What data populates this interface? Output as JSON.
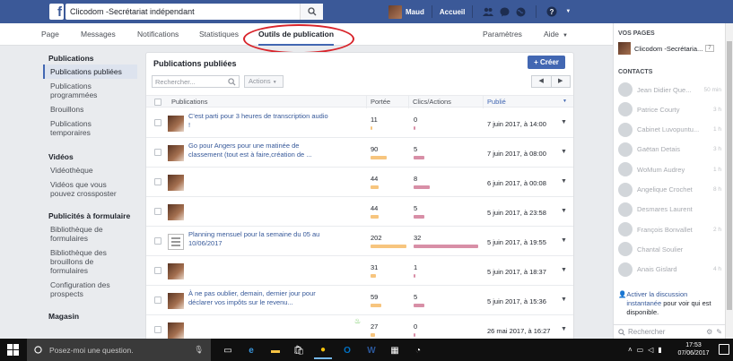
{
  "topbar": {
    "page_name": "Clicodom -Secrétariat indépendant",
    "user_name": "Maud",
    "home_label": "Accueil"
  },
  "tabs": [
    {
      "label": "Page"
    },
    {
      "label": "Messages"
    },
    {
      "label": "Notifications"
    },
    {
      "label": "Statistiques"
    },
    {
      "label": "Outils de publication",
      "active": true
    },
    {
      "label": "Paramètres"
    },
    {
      "label": "Aide"
    }
  ],
  "leftnav": {
    "sections": [
      {
        "heading": "Publications",
        "items": [
          "Publications publiées",
          "Publications programmées",
          "Brouillons",
          "Publications temporaires"
        ]
      },
      {
        "heading": "Vidéos",
        "items": [
          "Vidéothèque",
          "Vidéos que vous pouvez crossposter"
        ]
      },
      {
        "heading": "Publicités à formulaire",
        "items": [
          "Bibliothèque de formulaires",
          "Bibliothèque des brouillons de formulaires",
          "Configuration des prospects"
        ]
      },
      {
        "heading": "Magasin",
        "items": []
      }
    ],
    "active_item": "Publications publiées"
  },
  "main": {
    "title": "Publications publiées",
    "create_label": "+ Créer",
    "search_placeholder": "Rechercher...",
    "actions_label": "Actions",
    "pager_prev": "◀",
    "pager_next": "▶",
    "columns": {
      "publications": "Publications",
      "reach": "Portée",
      "clicks": "Clics/Actions",
      "published": "Publié"
    },
    "rows": [
      {
        "title": "C'est parti pour 3 heures de transcription audio !",
        "reach": "11",
        "reach_frac": 0.05,
        "clicks": "0",
        "clicks_frac": 0.0,
        "date": "7 juin 2017, à 14:00",
        "thumb": "photo",
        "boost": false
      },
      {
        "title": "Go pour Angers pour une matinée de classement (tout est à faire,création de ...",
        "reach": "90",
        "reach_frac": 0.45,
        "clicks": "5",
        "clicks_frac": 0.16,
        "date": "7 juin 2017, à 08:00",
        "thumb": "photo",
        "boost": false
      },
      {
        "title": "",
        "reach": "44",
        "reach_frac": 0.22,
        "clicks": "8",
        "clicks_frac": 0.25,
        "date": "6 juin 2017, à 00:08",
        "thumb": "photo",
        "boost": false
      },
      {
        "title": "",
        "reach": "44",
        "reach_frac": 0.22,
        "clicks": "5",
        "clicks_frac": 0.16,
        "date": "5 juin 2017, à 23:58",
        "thumb": "photo",
        "boost": false
      },
      {
        "title": "Planning mensuel pour la semaine du 05 au 10/06/2017",
        "reach": "202",
        "reach_frac": 1.0,
        "clicks": "32",
        "clicks_frac": 1.0,
        "date": "5 juin 2017, à 19:55",
        "thumb": "doc",
        "boost": false
      },
      {
        "title": "",
        "reach": "31",
        "reach_frac": 0.15,
        "clicks": "1",
        "clicks_frac": 0.03,
        "date": "5 juin 2017, à 18:37",
        "thumb": "photo",
        "boost": false
      },
      {
        "title": "À ne pas oublier, demain, dernier jour pour déclarer vos impôts sur le revenu...",
        "reach": "59",
        "reach_frac": 0.29,
        "clicks": "5",
        "clicks_frac": 0.16,
        "date": "5 juin 2017, à 15:36",
        "thumb": "photo",
        "boost": false
      },
      {
        "title": "",
        "reach": "27",
        "reach_frac": 0.13,
        "clicks": "0",
        "clicks_frac": 0.0,
        "date": "26 mai 2017, à 16:27",
        "thumb": "photo",
        "boost": true
      }
    ]
  },
  "rightbar": {
    "pages_heading": "VOS PAGES",
    "page_item": "Clicodom -Secrétaria...",
    "page_badge": "7",
    "contacts_heading": "CONTACTS",
    "contacts": [
      {
        "name": "Jean Didier Que...",
        "time": "50 min"
      },
      {
        "name": "Patrice Courty",
        "time": "3 h"
      },
      {
        "name": "Cabinet Luvopuntu...",
        "time": "1 h"
      },
      {
        "name": "Gaëtan Detais",
        "time": "3 h"
      },
      {
        "name": "WoMum Audrey",
        "time": "1 h"
      },
      {
        "name": "Angelique Crochet",
        "time": "8 h"
      },
      {
        "name": "Desmares Laurent",
        "time": ""
      },
      {
        "name": "François Bonvallet",
        "time": "2 h"
      },
      {
        "name": "Chantal Soulier",
        "time": ""
      },
      {
        "name": "Anais Gislard",
        "time": "4 h"
      }
    ],
    "info_link": "Activer la discussion instantanée",
    "info_rest": " pour voir qui est disponible.",
    "search_placeholder": "Rechercher"
  },
  "taskbar": {
    "search_placeholder": "Posez-moi une question.",
    "time": "17:53",
    "date": "07/06/2017"
  }
}
